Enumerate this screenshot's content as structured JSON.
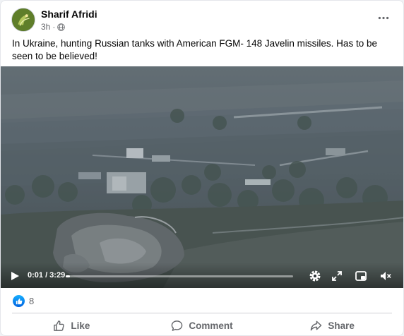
{
  "post": {
    "author": "Sharif Afridi",
    "timestamp": "3h",
    "separator": "·",
    "caption": "In Ukraine, hunting Russian tanks with American FGM- 148 Javelin missiles. Has to be seen to be believed!"
  },
  "video": {
    "current_time": "0:01",
    "duration": "3:29",
    "time_display": "0:01 / 3:29",
    "progress": 0.005
  },
  "reactions": {
    "count": "8",
    "type": "like-icon"
  },
  "actions": {
    "like_label": "Like",
    "comment_label": "Comment",
    "share_label": "Share"
  },
  "colors": {
    "text_primary": "#050505",
    "text_secondary": "#65676b",
    "like_blue": "#0866ff",
    "divider": "#ced0d4"
  }
}
